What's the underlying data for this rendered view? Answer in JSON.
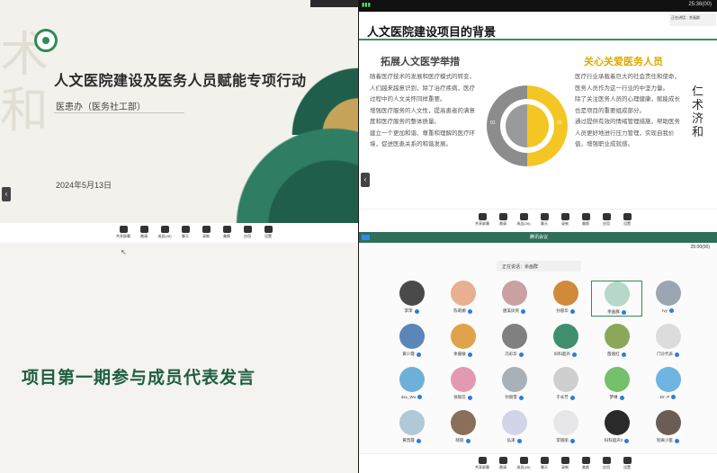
{
  "toolbar": {
    "share": "共享屏幕",
    "invite": "邀请",
    "members": "成员(26)",
    "chat": "聊天",
    "record": "录制",
    "effects": "美颜",
    "apps": "应用",
    "settings": "设置"
  },
  "q1": {
    "title": "人文医院建设及医务人员赋能专项行动",
    "subtitle": "医患办（医务社工部）",
    "date": "2024年5月13日"
  },
  "q2": {
    "top_info": "25:36(00)",
    "talk_label": "正在讲话：余画群",
    "slide_title": "人文医院建设项目的背景",
    "left_heading": "拓展人文医学举措",
    "right_heading": "关心关爱医务人员",
    "left_bullets": [
      "随着医疗技术的发展和医疗模式的转变，人们越来越意识到，除了治疗疾病，医疗过程中的人文关怀同样重要。",
      "增强医疗服务的人文性，提高患者的满意度和医疗服务的整体质量。",
      "建立一个更加和谐、尊重和理解的医疗环境，促进医患关系的和谐发展。"
    ],
    "right_bullets": [
      "医疗行业承载着巨大的社会责任和使命，医务人员作为这一行业的中坚力量。",
      "除了关注医务人员的心理健康，赋能成长也是项目的重要组成部分。",
      "通过提供有效的情绪管理措施，帮助医务人员更好地进行压力管理，实现自我价值，增强职业成就感。"
    ],
    "circle_left": "01",
    "circle_right": "02",
    "calligraphy": "仁术济和"
  },
  "q3": {
    "headline": "项目第一期参与成员代表发言"
  },
  "q4": {
    "task_label": "腾讯会议",
    "clock": "25:00(00)",
    "speaking": "正在说话：余画群",
    "participants": [
      {
        "name": "李萍",
        "color": "#4a4a4a"
      },
      {
        "name": "陈莉娜",
        "color": "#e8b090"
      },
      {
        "name": "唐美凤英",
        "color": "#c9a1a1"
      },
      {
        "name": "孙丽华",
        "color": "#d08a3a"
      },
      {
        "name": "余画群",
        "color": "#b7d7c8"
      },
      {
        "name": "Ivy",
        "color": "#9aa6b2"
      },
      {
        "name": "黄少霞",
        "color": "#5b87b8"
      },
      {
        "name": "余嘉敏",
        "color": "#e0a24a"
      },
      {
        "name": "冯彩华",
        "color": "#808080"
      },
      {
        "name": "妇科超声",
        "color": "#3f8f6f"
      },
      {
        "name": "殷丽红",
        "color": "#8aa858"
      },
      {
        "name": "门诊代表",
        "color": "#dcdcdc"
      },
      {
        "name": "dxx_Wu",
        "color": "#6db0d8"
      },
      {
        "name": "徐丽云",
        "color": "#e29ab2"
      },
      {
        "name": "孙丽雪",
        "color": "#a8b0b8"
      },
      {
        "name": "于长芳",
        "color": "#cfcfcf"
      },
      {
        "name": "梦琳",
        "color": "#74c06b"
      },
      {
        "name": "Dr- P",
        "color": "#6fb4e3"
      },
      {
        "name": "黄晋霞",
        "color": "#b0c8d8"
      },
      {
        "name": "晓丽",
        "color": "#8c6f5a"
      },
      {
        "name": "弘泽",
        "color": "#d1d5e8"
      },
      {
        "name": "李丽丽",
        "color": "#e7e7ea"
      },
      {
        "name": "妇科超声2",
        "color": "#2a2a2a"
      },
      {
        "name": "别离小医",
        "color": "#6b5d55"
      }
    ]
  }
}
